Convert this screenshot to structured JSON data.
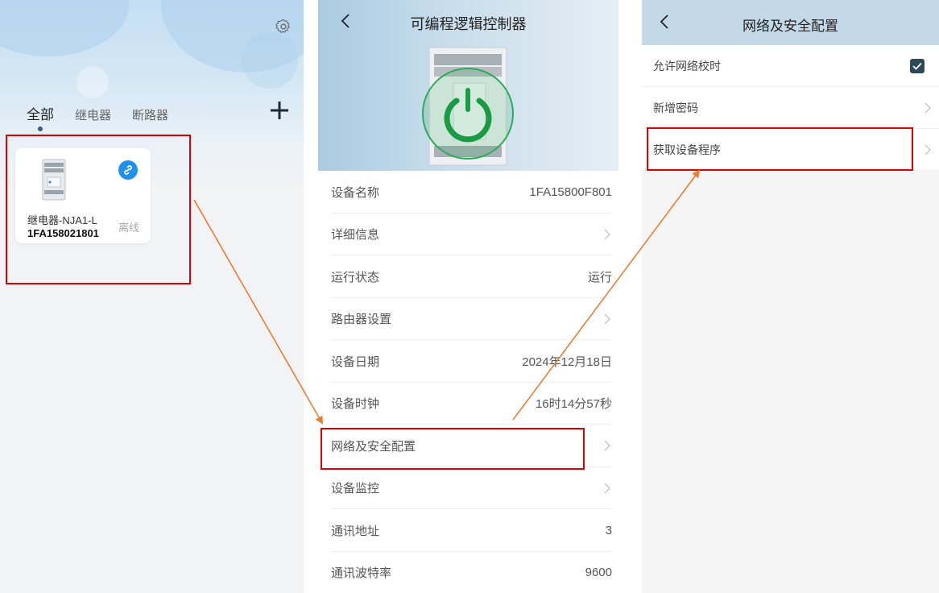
{
  "panel1": {
    "tabs": [
      "全部",
      "继电器",
      "断路器"
    ],
    "active_tab": 0,
    "device": {
      "name": "继电器-NJA1-L",
      "id": "1FA158021801",
      "status": "离线",
      "link_icon": "link-icon"
    },
    "icons": {
      "settings": "gear-icon",
      "add": "plus-icon"
    }
  },
  "panel2": {
    "title": "可编程逻辑控制器",
    "rows": [
      {
        "label": "设备名称",
        "value": "1FA15800F801",
        "chevron": false
      },
      {
        "label": "详细信息",
        "value": "",
        "chevron": true
      },
      {
        "label": "运行状态",
        "value": "运行",
        "chevron": false
      },
      {
        "label": "路由器设置",
        "value": "",
        "chevron": true
      },
      {
        "label": "设备日期",
        "value": "2024年12月18日",
        "chevron": false
      },
      {
        "label": "设备时钟",
        "value": "16时14分57秒",
        "chevron": false
      },
      {
        "label": "网络及安全配置",
        "value": "",
        "chevron": true
      },
      {
        "label": "设备监控",
        "value": "",
        "chevron": true
      },
      {
        "label": "通讯地址",
        "value": "3",
        "chevron": false
      },
      {
        "label": "通讯波特率",
        "value": "9600",
        "chevron": false
      }
    ]
  },
  "panel3": {
    "title": "网络及安全配置",
    "rows": [
      {
        "label": "允许网络校时",
        "checkbox": true,
        "checked": true
      },
      {
        "label": "新增密码",
        "chevron": true
      },
      {
        "label": "获取设备程序",
        "chevron": true
      }
    ]
  },
  "colors": {
    "highlight": "#e00000",
    "arrow": "#ed7d31",
    "checkbox": "#2f4858",
    "link_badge": "#1f8ff0"
  }
}
